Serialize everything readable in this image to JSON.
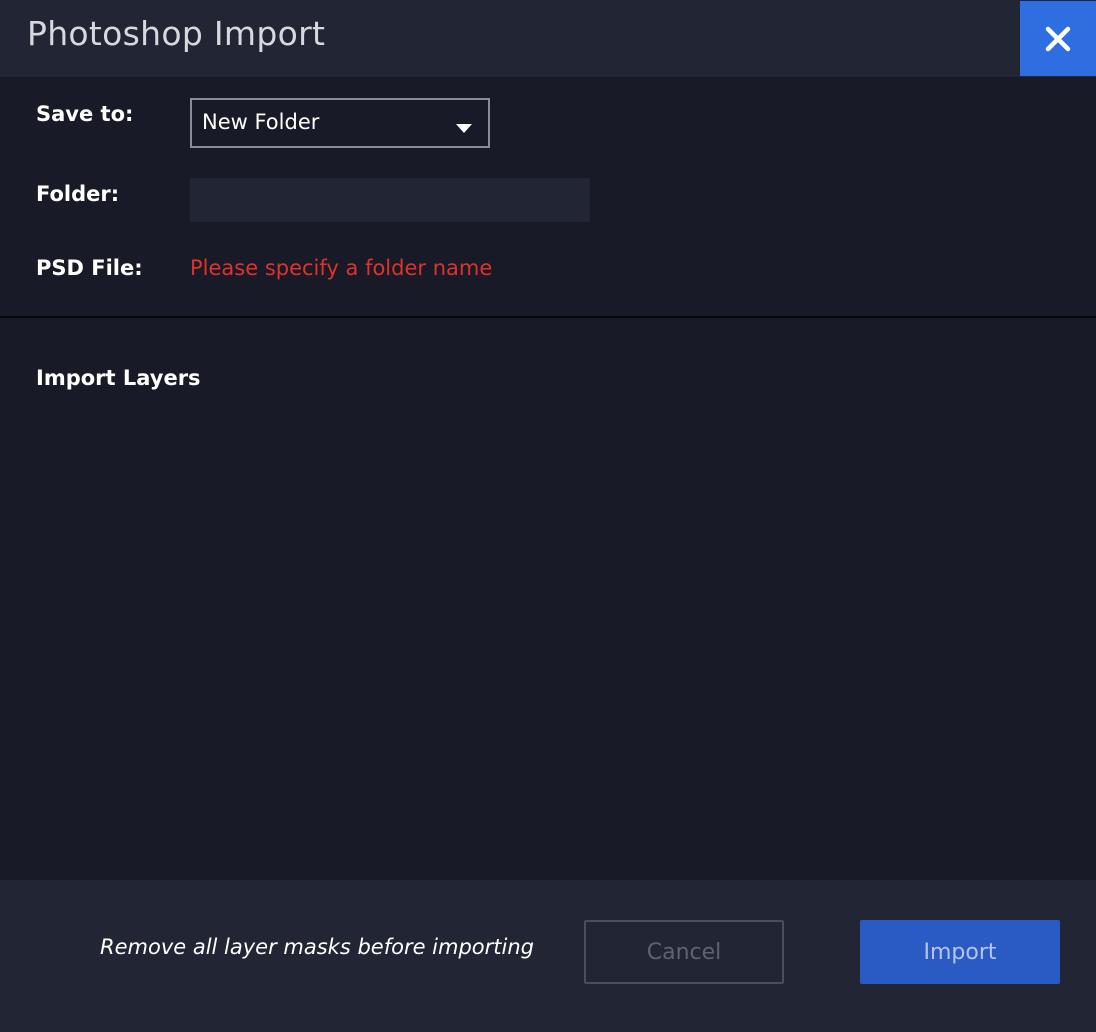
{
  "dialog": {
    "title": "Photoshop Import",
    "close_icon": "close-icon"
  },
  "form": {
    "save_to_label": "Save to:",
    "save_to_value": "New Folder",
    "folder_label": "Folder:",
    "folder_value": "",
    "psd_file_label": "PSD File:",
    "psd_file_error": "Please specify a folder name"
  },
  "layers": {
    "title": "Import Layers"
  },
  "footer": {
    "note": "Remove all layer masks before importing",
    "cancel_label": "Cancel",
    "import_label": "Import"
  },
  "colors": {
    "accent": "#2f6ee0",
    "error": "#e0322c",
    "background": "#181a27",
    "panel": "#222533"
  }
}
